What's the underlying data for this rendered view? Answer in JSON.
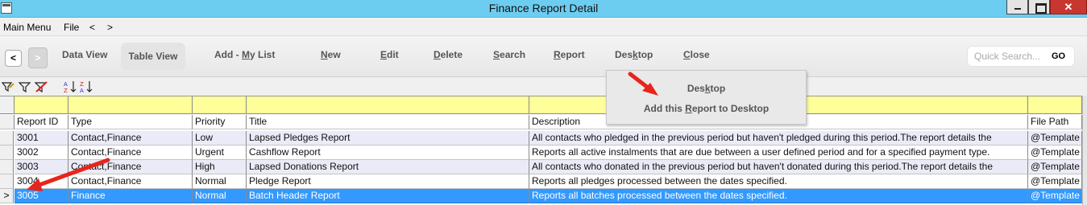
{
  "window": {
    "title": "Finance Report Detail"
  },
  "menu": {
    "items": [
      "Main Menu",
      "File",
      "<",
      ">"
    ]
  },
  "toolbar": {
    "back": "<",
    "forward": ">",
    "data_view": "Data View",
    "table_view": "Table View",
    "add_my_list_pre": "Add - ",
    "add_my_list_u": "M",
    "add_my_list_post": "y List",
    "new_u": "N",
    "new_rest": "ew",
    "edit_u": "E",
    "edit_rest": "dit",
    "delete_u": "D",
    "delete_rest": "elete",
    "search_u": "S",
    "search_rest": "earch",
    "report_u": "R",
    "report_rest": "eport",
    "desktop_pre": "Des",
    "desktop_u": "k",
    "desktop_post": "top",
    "close_u": "C",
    "close_rest": "lose",
    "quick_search_placeholder": "Quick Search...",
    "go": "GO"
  },
  "desktop_menu": {
    "item1_pre": "Des",
    "item1_u": "k",
    "item1_post": "top",
    "item2_pre": "Add this ",
    "item2_u": "R",
    "item2_post": "eport to Desktop"
  },
  "grid": {
    "columns": [
      "Report ID",
      "Type",
      "Priority",
      "Title",
      "Description",
      "File Path"
    ],
    "rows": [
      {
        "id": "3001",
        "type": "Contact,Finance",
        "priority": "Low",
        "title": "Lapsed Pledges Report",
        "description": "All contacts who pledged in the previous period but haven't pledged during this period.The report details the",
        "path": "@Template"
      },
      {
        "id": "3002",
        "type": "Contact,Finance",
        "priority": "Urgent",
        "title": "Cashflow Report",
        "description": "Reports all active instalments that are due between a user defined period and for a specified payment type.",
        "path": "@Template"
      },
      {
        "id": "3003",
        "type": "Contact,Finance",
        "priority": "High",
        "title": "Lapsed Donations Report",
        "description": "All contacts who donated in the previous period but haven't donated during this period.The report details the",
        "path": "@Template"
      },
      {
        "id": "3004",
        "type": "Contact,Finance",
        "priority": "Normal",
        "title": "Pledge Report",
        "description": "Reports all pledges processed between the dates specified.",
        "path": "@Template"
      },
      {
        "id": "3005",
        "type": "Finance",
        "priority": "Normal",
        "title": "Batch Header Report",
        "description": "Reports all batches processed between the dates specified.",
        "path": "@Template"
      }
    ],
    "selected_marker": ">"
  },
  "colors": {
    "titlebar": "#6dcdf1",
    "selection": "#3399ff",
    "filter_row": "#ffff99",
    "arrow": "#e8241c"
  }
}
